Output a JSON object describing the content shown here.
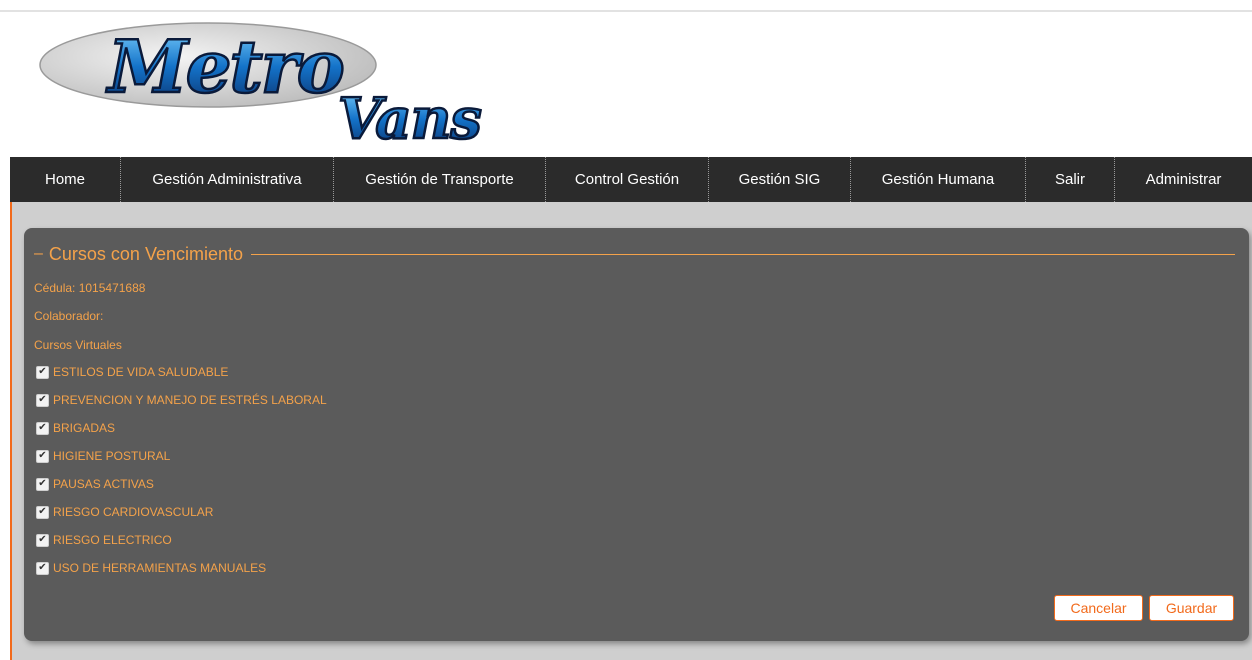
{
  "logo": {
    "line1": "Metro",
    "line2": "Vans"
  },
  "nav": {
    "items": [
      {
        "label": "Home"
      },
      {
        "label": "Gestión Administrativa"
      },
      {
        "label": "Gestión de Transporte"
      },
      {
        "label": "Control Gestión"
      },
      {
        "label": "Gestión SIG"
      },
      {
        "label": "Gestión Humana"
      },
      {
        "label": "Salir"
      },
      {
        "label": "Administrar"
      }
    ]
  },
  "form": {
    "title": "Cursos con Vencimiento",
    "legend_dash": "–",
    "cedula": "Cédula: 1015471688",
    "colaborador": "Colaborador:",
    "section_label": "Cursos Virtuales",
    "courses": [
      {
        "label": "ESTILOS DE VIDA SALUDABLE",
        "checked": true
      },
      {
        "label": "PREVENCION Y MANEJO DE ESTRÉS LABORAL",
        "checked": true
      },
      {
        "label": "BRIGADAS",
        "checked": true
      },
      {
        "label": "HIGIENE POSTURAL",
        "checked": true
      },
      {
        "label": "PAUSAS ACTIVAS",
        "checked": true
      },
      {
        "label": "RIESGO CARDIOVASCULAR",
        "checked": true
      },
      {
        "label": "RIESGO ELECTRICO",
        "checked": true
      },
      {
        "label": "USO DE HERRAMIENTAS MANUALES",
        "checked": true
      }
    ],
    "cancel_label": "Cancelar",
    "save_label": "Guardar"
  },
  "colors": {
    "accent": "#f26a1b",
    "label_orange": "#f4a24a",
    "nav_bg": "#2b2b2b",
    "panel_bg": "#5b5b5b"
  }
}
